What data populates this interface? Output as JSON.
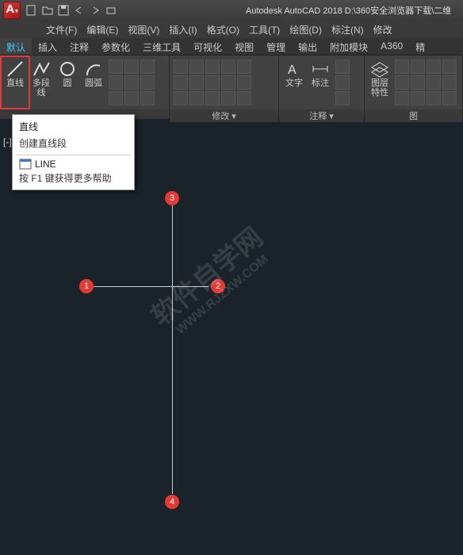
{
  "title": "Autodesk AutoCAD 2018     D:\\360安全浏览器下载\\二维",
  "menu": [
    "文件(F)",
    "编辑(E)",
    "视图(V)",
    "插入(I)",
    "格式(O)",
    "工具(T)",
    "绘图(D)",
    "标注(N)",
    "修改"
  ],
  "tabs": [
    "默认",
    "插入",
    "注释",
    "参数化",
    "三维工具",
    "可视化",
    "视图",
    "管理",
    "输出",
    "附加模块",
    "A360",
    "精"
  ],
  "panel": {
    "line": "直线",
    "polyline": "多段线",
    "circle": "圆",
    "arc": "圆弧",
    "text": "文字",
    "dim": "标注",
    "layer": "图层",
    "props": "特性",
    "g_modify": "修改 ▾",
    "g_annot": "注释 ▾",
    "g_layer": "图"
  },
  "tooltip": {
    "title": "直线",
    "sub": "创建直线段",
    "cmd": "LINE",
    "f1": "按 F1 键获得更多帮助"
  },
  "viewport_label": "[-][",
  "markers": {
    "m1": "1",
    "m2": "2",
    "m3": "3",
    "m4": "4"
  },
  "watermark": {
    "line1": "软件自学网",
    "line2": "WWW.RJZXW.COM"
  },
  "colors": {
    "accent": "#e53935"
  }
}
